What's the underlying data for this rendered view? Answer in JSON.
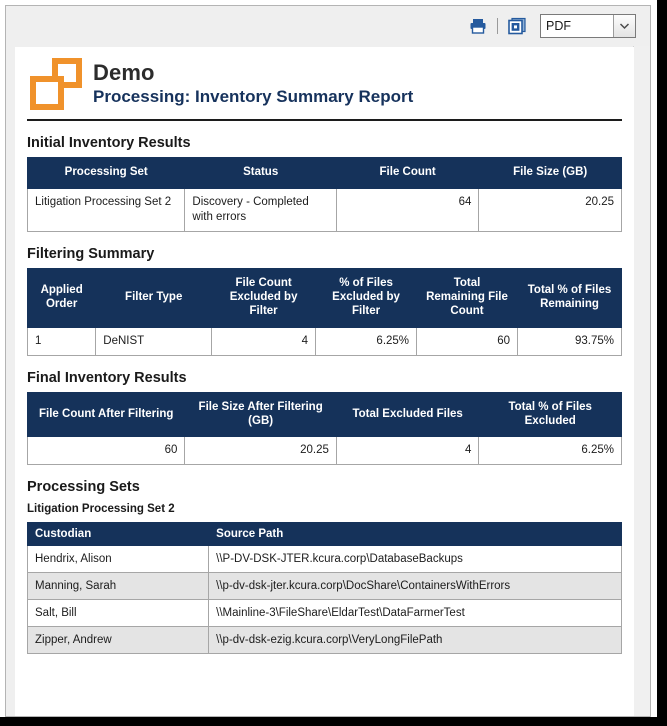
{
  "toolbar": {
    "print_icon": "printer-icon",
    "export_icon": "export-save-icon",
    "format_value": "PDF",
    "format_options": [
      "PDF"
    ],
    "caret_icon": "chevron-down-icon"
  },
  "report": {
    "logo_name": "relativity-logo",
    "title": "Demo",
    "subtitle": "Processing: Inventory Summary Report"
  },
  "initial_inventory": {
    "heading": "Initial Inventory Results",
    "columns": [
      "Processing Set",
      "Status",
      "File Count",
      "File Size (GB)"
    ],
    "rows": [
      {
        "processing_set": "Litigation Processing Set 2",
        "status": "Discovery - Completed with errors",
        "file_count": "64",
        "file_size_gb": "20.25"
      }
    ]
  },
  "filtering_summary": {
    "heading": "Filtering Summary",
    "columns": [
      "Applied Order",
      "Filter Type",
      "File Count Excluded by Filter",
      "% of Files Excluded by Filter",
      "Total Remaining File Count",
      "Total % of Files Remaining"
    ],
    "rows": [
      {
        "applied_order": "1",
        "filter_type": "DeNIST",
        "file_count_excluded": "4",
        "pct_files_excluded": "6.25%",
        "total_remaining_count": "60",
        "total_pct_remaining": "93.75%"
      }
    ]
  },
  "final_inventory": {
    "heading": "Final Inventory Results",
    "columns": [
      "File Count After Filtering",
      "File Size After Filtering (GB)",
      "Total Excluded Files",
      "Total % of Files Excluded"
    ],
    "rows": [
      {
        "file_count_after": "60",
        "file_size_after": "20.25",
        "total_excluded": "4",
        "total_pct_excluded": "6.25%"
      }
    ]
  },
  "processing_sets": {
    "heading": "Processing Sets",
    "set_name": "Litigation Processing Set 2",
    "columns": [
      "Custodian",
      "Source Path"
    ],
    "rows": [
      {
        "custodian": "Hendrix, Alison",
        "source_path": "\\\\P-DV-DSK-JTER.kcura.corp\\DatabaseBackups"
      },
      {
        "custodian": "Manning, Sarah",
        "source_path": "\\\\p-dv-dsk-jter.kcura.corp\\DocShare\\ContainersWithErrors"
      },
      {
        "custodian": "Salt, Bill",
        "source_path": "\\\\Mainline-3\\FileShare\\EldarTest\\DataFarmerTest"
      },
      {
        "custodian": "Zipper, Andrew",
        "source_path": "\\\\p-dv-dsk-ezig.kcura.corp\\VeryLongFilePath"
      }
    ]
  },
  "colors": {
    "table_header_navy": "#15325a",
    "logo_orange": "#f0922b",
    "icon_blue": "#255a9e",
    "row_stripe": "#e4e4e4"
  }
}
